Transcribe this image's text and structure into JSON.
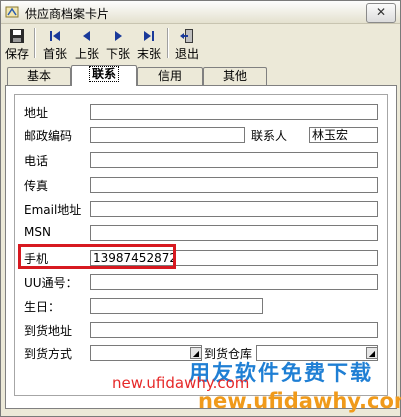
{
  "window": {
    "title": "供应商档案卡片",
    "close_label": "✕"
  },
  "toolbar": {
    "buttons": [
      {
        "label": "保存",
        "icon": "save-icon"
      },
      {
        "label": "首张",
        "icon": "first-record-icon"
      },
      {
        "label": "上张",
        "icon": "prev-record-icon"
      },
      {
        "label": "下张",
        "icon": "next-record-icon"
      },
      {
        "label": "末张",
        "icon": "last-record-icon"
      },
      {
        "label": "退出",
        "icon": "exit-icon"
      }
    ]
  },
  "tabs": [
    {
      "label": "基本",
      "active": false
    },
    {
      "label": "联系",
      "active": true
    },
    {
      "label": "信用",
      "active": false
    },
    {
      "label": "其他",
      "active": false
    }
  ],
  "form": {
    "address": {
      "label": "地址",
      "value": ""
    },
    "postcode": {
      "label": "邮政编码",
      "value": ""
    },
    "contact": {
      "label": "联系人",
      "value": "林玉宏"
    },
    "phone": {
      "label": "电话",
      "value": ""
    },
    "fax": {
      "label": "传真",
      "value": ""
    },
    "email": {
      "label": "Email地址",
      "value": ""
    },
    "msn": {
      "label": "MSN",
      "value": ""
    },
    "mobile": {
      "label": "手机",
      "value": "13987452872"
    },
    "uu": {
      "label": "UU通号：",
      "value": ""
    },
    "birthday": {
      "label": "生日：",
      "value": ""
    },
    "delivery_address": {
      "label": "到货地址",
      "value": ""
    },
    "delivery_method": {
      "label": "到货方式",
      "value": ""
    },
    "delivery_warehouse": {
      "label": "到货仓库",
      "value": ""
    }
  },
  "watermark": {
    "brand": "用友软件免费下载",
    "url_red": "new.ufidawhy.com",
    "url_orange": "new.ufidawhy.com"
  },
  "colors": {
    "highlight": "#d71920",
    "watermark_blue": "#1f7fd4",
    "watermark_red": "#e62828",
    "watermark_orange": "#f09a1a"
  }
}
